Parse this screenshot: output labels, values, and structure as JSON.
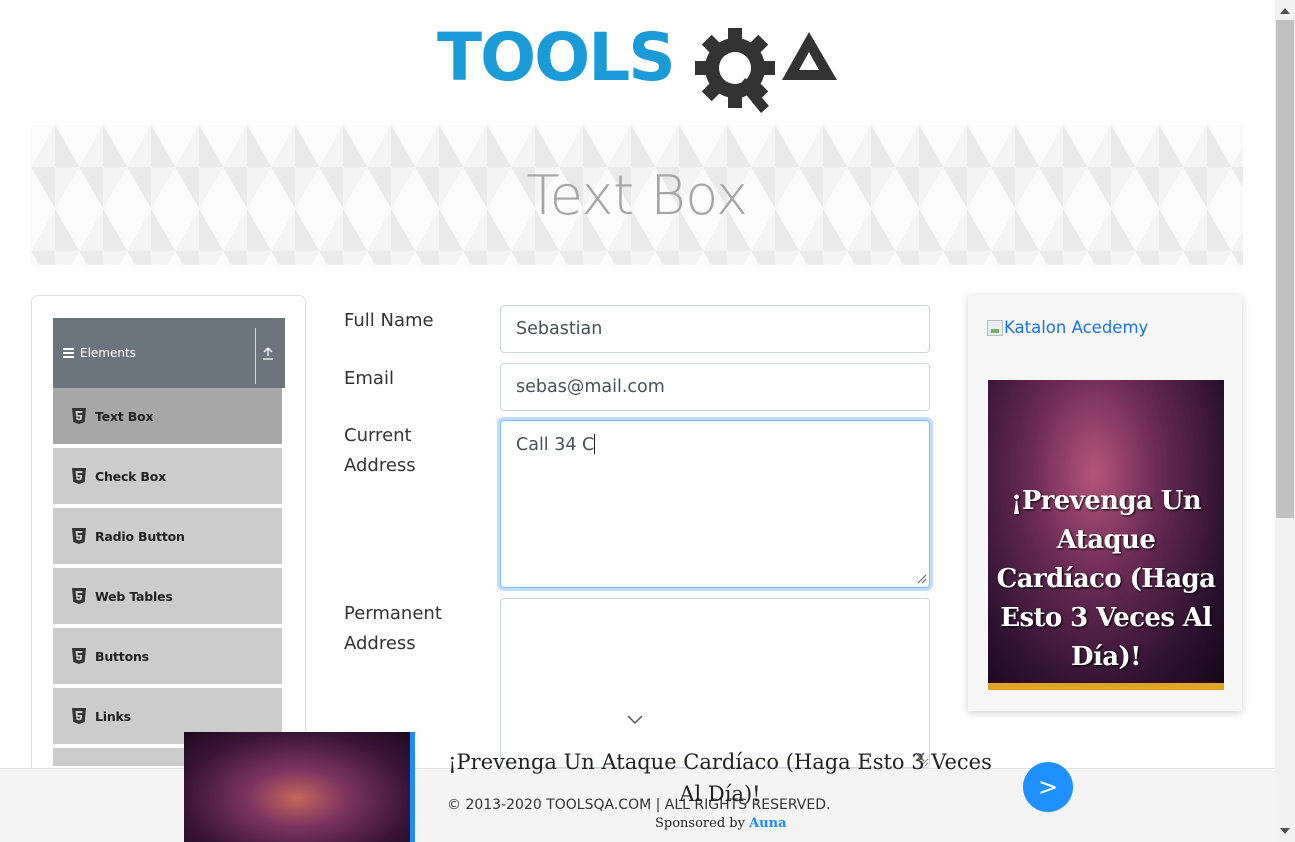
{
  "header": {
    "logo_text_left": "TOOLS",
    "logo_text_right": "QA"
  },
  "banner": {
    "title": "Text Box"
  },
  "sidebar": {
    "group_title": "Elements",
    "items": [
      {
        "label": "Text Box",
        "active": true
      },
      {
        "label": "Check Box"
      },
      {
        "label": "Radio Button"
      },
      {
        "label": "Web Tables"
      },
      {
        "label": "Buttons"
      },
      {
        "label": "Links"
      }
    ]
  },
  "form": {
    "full_name": {
      "label": "Full Name",
      "value": "Sebastian"
    },
    "email": {
      "label": "Email",
      "value": "sebas@mail.com"
    },
    "current_address": {
      "label_line1": "Current",
      "label_line2": "Address",
      "value": "Call 34 C"
    },
    "permanent_address": {
      "label_line1": "Permanent",
      "label_line2": "Address",
      "value": ""
    }
  },
  "ad_panel": {
    "link_text": "Katalon Acedemy",
    "headline": "¡Prevenga Un Ataque Cardíaco (Haga Esto 3 Veces Al Día)!"
  },
  "footer": {
    "copyright": "© 2013-2020 TOOLSQA.COM | ALL RIGHTS RESERVED."
  },
  "sticky_ad": {
    "headline": "¡Prevenga Un Ataque Cardíaco (Haga Esto 3 Veces Al Día)!",
    "sponsored_prefix": "Sponsored by",
    "sponsor": "Auna",
    "next_label": ">"
  },
  "colors": {
    "accent_blue": "#1a8cff",
    "logo_blue": "#1a9bd7",
    "logo_dark": "#333333",
    "gold": "#e0a526"
  }
}
